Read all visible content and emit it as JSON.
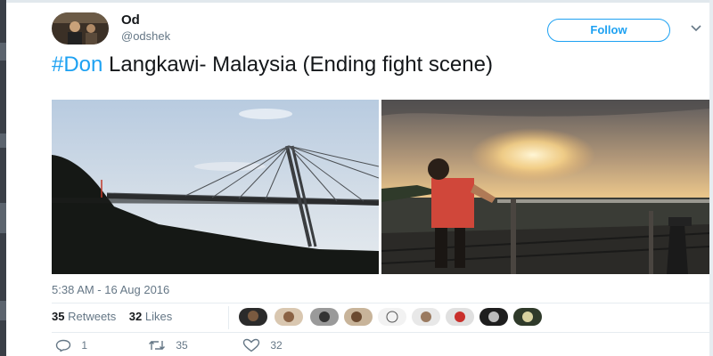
{
  "author": {
    "name": "Od",
    "handle": "@odshek",
    "avatar_icon": "profile-photo"
  },
  "follow_label": "Follow",
  "tweet": {
    "hashtag": "#Don",
    "text": " Langkawi- Malaysia (Ending fight scene)"
  },
  "timestamp": "5:38 AM - 16 Aug 2016",
  "stats": {
    "retweets_count": "35",
    "retweets_label": "Retweets",
    "likes_count": "32",
    "likes_label": "Likes"
  },
  "likers": [
    "liker-avatar-1",
    "liker-avatar-2",
    "liker-avatar-3",
    "liker-avatar-4",
    "liker-avatar-5",
    "liker-avatar-6",
    "liker-avatar-7",
    "liker-avatar-8",
    "liker-avatar-9"
  ],
  "actions": {
    "reply_count": "1",
    "retweet_count": "35",
    "like_count": "32"
  },
  "colors": {
    "link": "#1da1f2",
    "muted": "#657786",
    "text": "#14171a"
  }
}
